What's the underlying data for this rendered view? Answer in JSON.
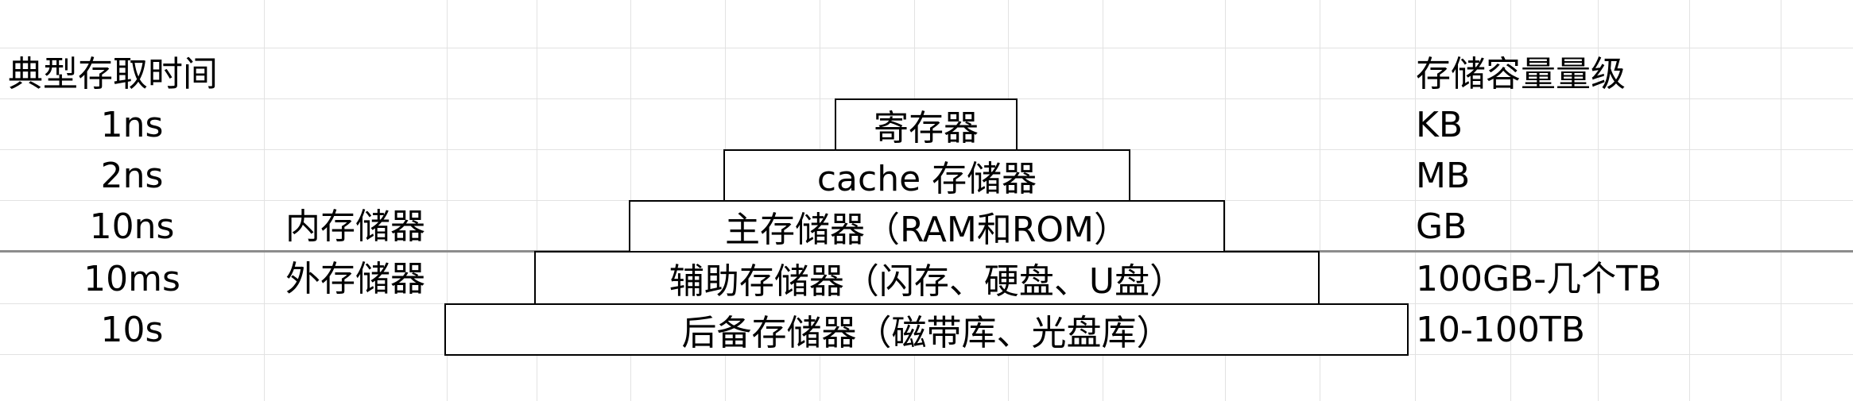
{
  "headers": {
    "access_time": "典型存取时间",
    "capacity": "存储容量量级"
  },
  "rows": [
    {
      "time": "1ns",
      "memory_type": "",
      "tier": "寄存器",
      "capacity": "KB"
    },
    {
      "time": "2ns",
      "memory_type": "",
      "tier": "cache 存储器",
      "capacity": "MB"
    },
    {
      "time": "10ns",
      "memory_type": "内存储器",
      "tier": "主存储器（RAM和ROM）",
      "capacity": "GB"
    },
    {
      "time": "10ms",
      "memory_type": "外存储器",
      "tier": "辅助存储器（闪存、硬盘、U盘）",
      "capacity": "100GB-几个TB"
    },
    {
      "time": "10s",
      "memory_type": "",
      "tier": "后备存储器（磁带库、光盘库）",
      "capacity": "10-100TB"
    }
  ],
  "colors": {
    "gridline": "#e2e2e2",
    "divider": "#8c8c8c",
    "box_border": "#000000",
    "background": "#ffffff"
  }
}
